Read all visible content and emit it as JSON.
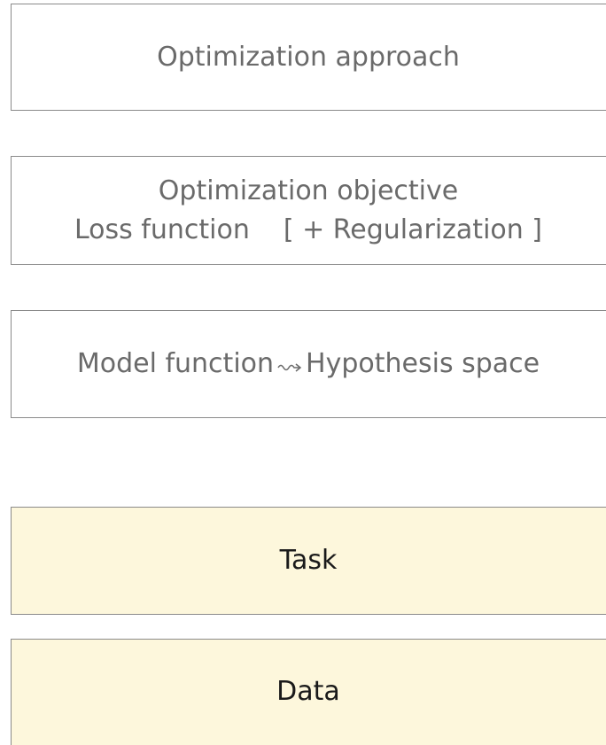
{
  "layers": {
    "optimization_approach": {
      "label": "Optimization approach"
    },
    "optimization_objective": {
      "title": "Optimization objective",
      "loss": "Loss function",
      "regularization": "[ + Regularization ]"
    },
    "model": {
      "model_function": "Model function",
      "arrow_symbol": "leadsto-arrow",
      "hypothesis_space": "Hypothesis space"
    },
    "task": {
      "label": "Task"
    },
    "data": {
      "label": "Data"
    }
  },
  "colors": {
    "box_border": "#8a8a8a",
    "upper_text": "#6a6a6a",
    "lower_fill": "#fdf7dc",
    "lower_text": "#1a1a1a"
  }
}
